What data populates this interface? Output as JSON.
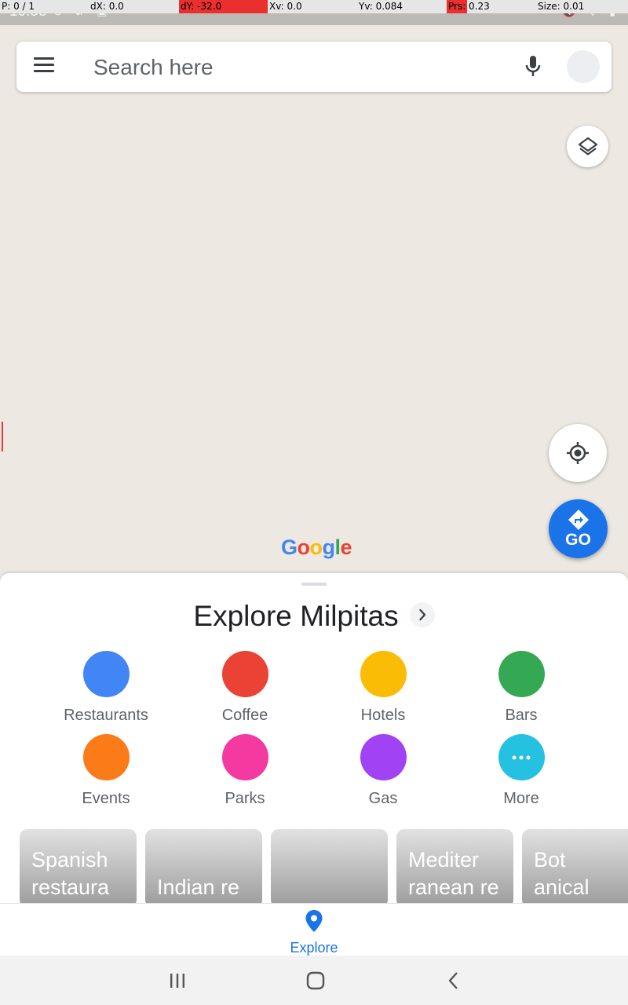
{
  "status": {
    "time": "10:58",
    "left_icons": "⊖ ⇵ ▣ ⋯",
    "right_icons": "🔇 ▽ ▮"
  },
  "debug": {
    "pointer": "P: 0 / 1",
    "dx": "dX: 0.0",
    "dy": "dY: -32.0",
    "xv": "Xv: 0.0",
    "yv": "Yv: 0.084",
    "prs_label": "Prs:",
    "prs_value": "0.23",
    "size": "Size: 0.01"
  },
  "search": {
    "placeholder": "Search here"
  },
  "map": {
    "go_label": "GO",
    "logo_letters": [
      "G",
      "o",
      "o",
      "g",
      "l",
      "e"
    ],
    "logo_colors": [
      "#4285f4",
      "#ea4335",
      "#fbbc05",
      "#4285f4",
      "#34a853",
      "#ea4335"
    ]
  },
  "explore": {
    "title": "Explore Milpitas",
    "categories": [
      {
        "label": "Restaurants",
        "color": "#4285f4"
      },
      {
        "label": "Coffee",
        "color": "#ea4335"
      },
      {
        "label": "Hotels",
        "color": "#fbbc05"
      },
      {
        "label": "Bars",
        "color": "#34a853"
      },
      {
        "label": "Events",
        "color": "#fa7b17"
      },
      {
        "label": "Parks",
        "color": "#f439a0"
      },
      {
        "label": "Gas",
        "color": "#a142f4"
      },
      {
        "label": "More",
        "color": "#24c1e0"
      }
    ],
    "cards": [
      {
        "text": "Spanish\nrestaura"
      },
      {
        "text": "Indian re"
      },
      {
        "text": ""
      },
      {
        "text": "Mediter\nranean re"
      },
      {
        "text": "Bot\nanical"
      }
    ]
  },
  "nav": {
    "explore_label": "Explore"
  },
  "colors": {
    "accent": "#1a73e8"
  }
}
